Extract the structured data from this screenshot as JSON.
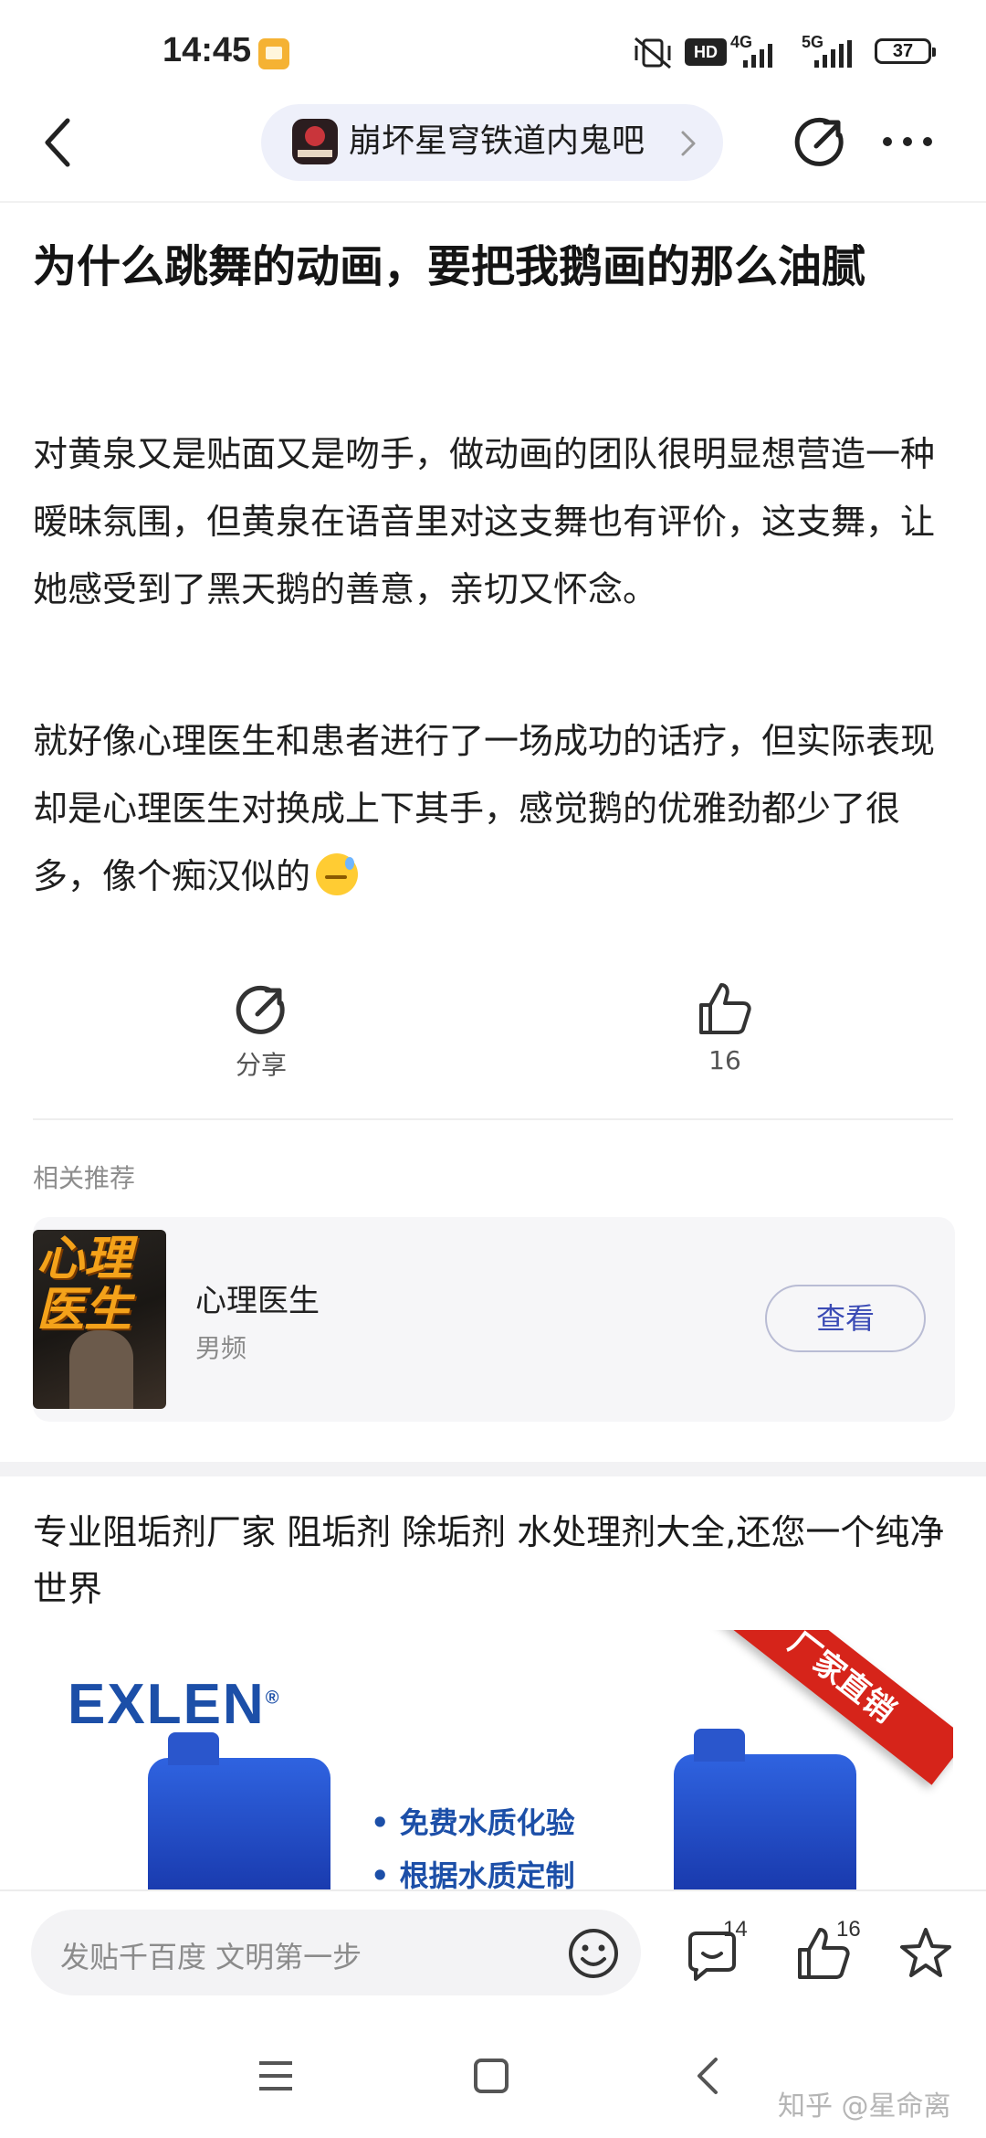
{
  "status_bar": {
    "time": "14:45",
    "hd_label": "HD",
    "network_1": "4G",
    "network_2": "5G",
    "battery": "37"
  },
  "header": {
    "forum_name": "崩坏星穹铁道内鬼吧"
  },
  "post": {
    "title": "为什么跳舞的动画，要把我鹅画的那么油腻",
    "paragraphs": [
      "对黄泉又是贴面又是吻手，做动画的团队很明显想营造一种暧昧氛围，但黄泉在语音里对这支舞也有评价，这支舞，让她感受到了黑天鹅的善意，亲切又怀念。",
      "就好像心理医生和患者进行了一场成功的话疗，但实际表现却是心理医生对换成上下其手，感觉鹅的优雅劲都少了很多，像个痴汉似的"
    ]
  },
  "actions": {
    "share_label": "分享",
    "like_count": "16"
  },
  "related": {
    "heading": "相关推荐",
    "book_cover_text": "心理医生",
    "title": "心理医生",
    "subtitle": "男频",
    "button_label": "查看"
  },
  "ad": {
    "text": "专业阻垢剂厂家 阻垢剂 除垢剂 水处理剂大全,还您一个纯净世界",
    "logo": "EXLEN",
    "ribbon": "厂家直销",
    "bullets": [
      "免费水质化验",
      "根据水质定制"
    ]
  },
  "bottom_bar": {
    "placeholder": "发贴千百度 文明第一步",
    "comment_count": "14",
    "like_count": "16"
  },
  "watermark": "知乎 @星命离"
}
